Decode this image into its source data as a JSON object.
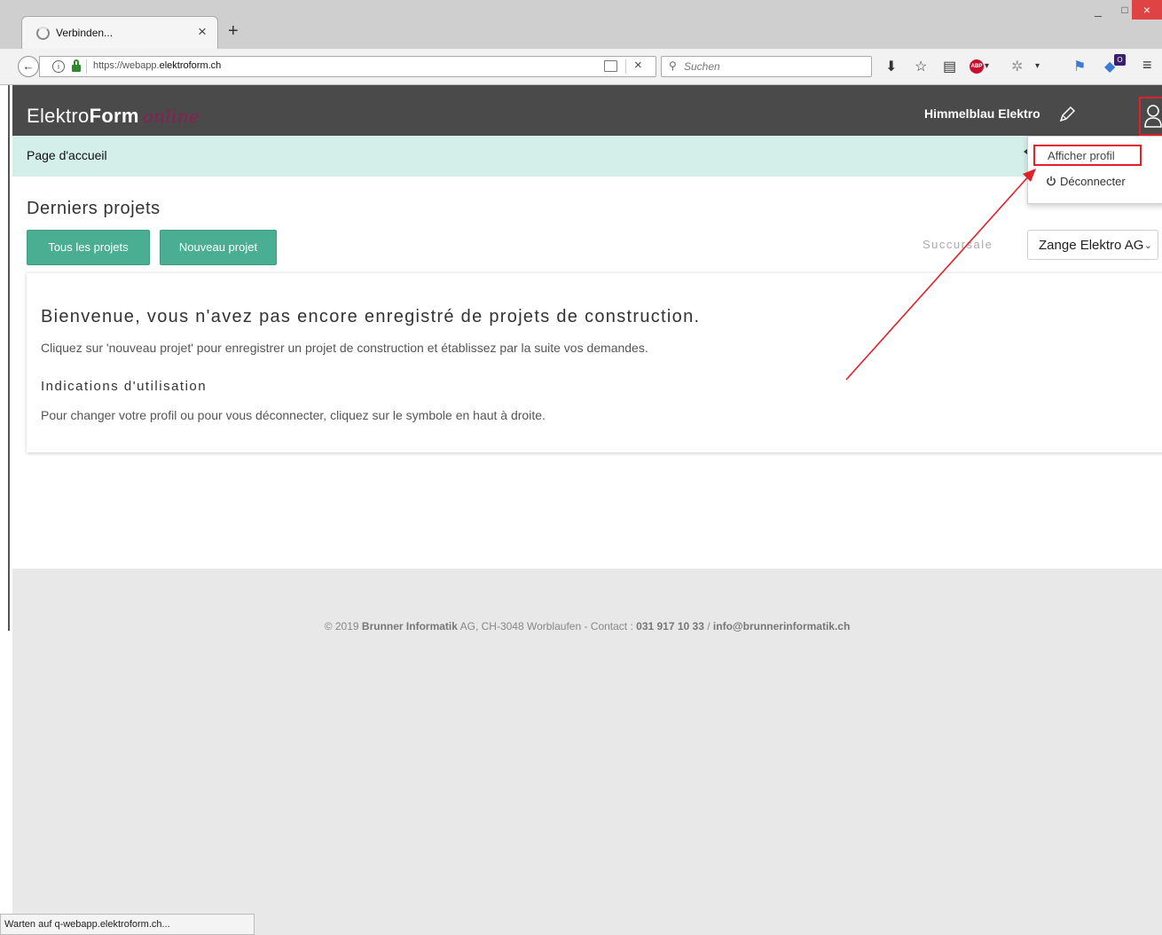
{
  "browser": {
    "tab_title": "Verbinden...",
    "tab_close": "×",
    "new_tab": "+",
    "window_controls": {
      "minimize": "_",
      "maximize": "□",
      "close": "×"
    },
    "back": "←",
    "info": "i",
    "url_prefix": "https://webapp.",
    "url_domain": "elektroform.ch",
    "url_stop": "×",
    "search_placeholder": "Suchen",
    "search_icon": "⚲",
    "toolbar_icons": [
      "download-icon",
      "bookmark-star-icon",
      "reading-list-icon",
      "adblock-icon",
      "extension-icon",
      "extension-icon",
      "extension-icon",
      "menu-icon"
    ],
    "download_glyph": "⬇",
    "star_glyph": "☆",
    "library_glyph": "▤",
    "abp_label": "ABP",
    "menu_glyph": "≡",
    "dropdown_glyph": "▾",
    "ext_badge": "O",
    "status": "Warten auf q-webapp.elektroform.ch..."
  },
  "app": {
    "brand_light": "Elektro",
    "brand_bold": "Form",
    "brand_accent": "online",
    "company": "Himmelblau Elektro",
    "accent_color": "#4aae92",
    "header_color": "#4a4a4a",
    "breadcrumb": "Page d'accueil"
  },
  "main": {
    "title": "Derniers projets",
    "btn_all": "Tous les projets",
    "btn_new": "Nouveau projet",
    "branch_label": "Succursale",
    "branch_value": "Zange Elektro AG",
    "branch_chevron": "⌄"
  },
  "welcome": {
    "title": "Bienvenue, vous n'avez pas encore enregistré de projets de construction.",
    "text": "Cliquez sur 'nouveau projet' pour enregistrer un projet de construction et établissez par la suite vos demandes.",
    "usage_title": "Indications d'utilisation",
    "usage_text": "Pour changer votre profil ou pour vous déconnecter, cliquez sur le symbole en haut à droite."
  },
  "user_menu": {
    "profile": "Afficher profil",
    "logout": "Déconnecter"
  },
  "footer": {
    "copyright": "© 2019 ",
    "company": "Brunner Informatik",
    "address": " AG, CH-3048 Worblaufen - Contact : ",
    "phone": "031 917 10 33",
    "sep": " / ",
    "email": "info@brunnerinformatik.ch"
  }
}
